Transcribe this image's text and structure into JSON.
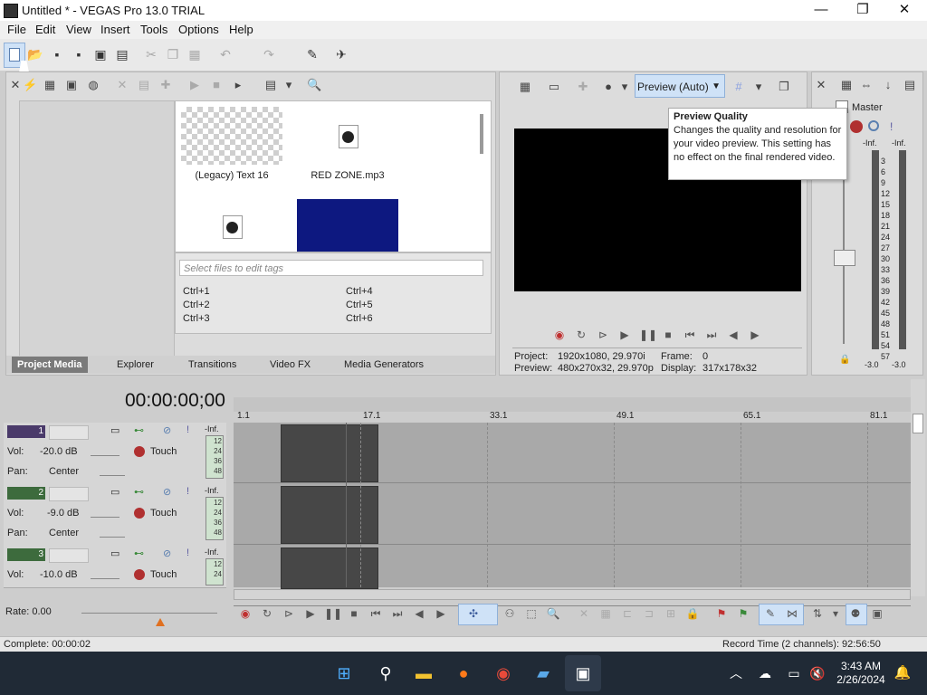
{
  "window": {
    "title": "Untitled * - VEGAS Pro 13.0 TRIAL",
    "controls": {
      "minimize": "—",
      "maximize": "❐",
      "close": "✕"
    }
  },
  "menu": [
    "File",
    "Edit",
    "View",
    "Insert",
    "Tools",
    "Options",
    "Help"
  ],
  "project_media": {
    "items": [
      {
        "label": "(Legacy) Text 16",
        "type": "text-media"
      },
      {
        "label": "RED ZONE.mp3",
        "type": "audio-file"
      },
      {
        "label": "",
        "type": "audio-file"
      },
      {
        "label": "",
        "type": "video-thumb"
      }
    ],
    "tag_placeholder": "Select files to edit tags",
    "shortcuts": [
      "Ctrl+1",
      "Ctrl+2",
      "Ctrl+3",
      "Ctrl+4",
      "Ctrl+5",
      "Ctrl+6"
    ],
    "tabs": [
      "Project Media",
      "Explorer",
      "Transitions",
      "Video FX",
      "Media Generators"
    ],
    "active_tab": "Project Media"
  },
  "preview": {
    "quality_label": "Preview (Auto)",
    "project_label": "Project:",
    "project_value": "1920x1080, 29.970i",
    "preview_label": "Preview:",
    "preview_value": "480x270x32, 29.970p",
    "frame_label": "Frame:",
    "frame_value": "0",
    "display_label": "Display:",
    "display_value": "317x178x32"
  },
  "tooltip": {
    "title": "Preview Quality",
    "body": "Changes the quality and resolution for your video preview. This setting has no effect on the final rendered video."
  },
  "master": {
    "title": "Master",
    "left_inf": "-Inf.",
    "right_inf": "-Inf.",
    "scale": [
      "3",
      "6",
      "9",
      "12",
      "15",
      "18",
      "21",
      "24",
      "27",
      "30",
      "33",
      "36",
      "39",
      "42",
      "45",
      "48",
      "51",
      "54",
      "57"
    ],
    "bottom_left": "-3.0",
    "bottom_right": "-3.0"
  },
  "timeline": {
    "timecode": "00:00:00;00",
    "ruler": [
      "1.1",
      "17.1",
      "33.1",
      "49.1",
      "65.1",
      "81.1"
    ],
    "rate_label": "Rate: 0.00",
    "tracks": [
      {
        "number": "1",
        "kind": "video",
        "vol_label": "Vol:",
        "vol_value": "-20.0 dB",
        "pan_label": "Pan:",
        "pan_value": "Center",
        "mode": "Touch",
        "inf": "-Inf."
      },
      {
        "number": "2",
        "kind": "audio",
        "vol_label": "Vol:",
        "vol_value": "-9.0 dB",
        "pan_label": "Pan:",
        "pan_value": "Center",
        "mode": "Touch",
        "inf": "-Inf."
      },
      {
        "number": "3",
        "kind": "audio",
        "vol_label": "Vol:",
        "vol_value": "-10.0 dB",
        "pan_label": "",
        "pan_value": "",
        "mode": "Touch",
        "inf": "-Inf."
      }
    ],
    "meter_scale": [
      "12",
      "24",
      "36",
      "48"
    ]
  },
  "status": {
    "complete": "Complete: 00:00:02",
    "record_time": "Record Time (2 channels): 92:56:50"
  },
  "taskbar": {
    "time": "3:43 AM",
    "date": "2/26/2024"
  },
  "colors": {
    "accent": "#cfe2f7",
    "track_video": "#4a3a6a",
    "track_audio": "#3d6b3d",
    "clip": "#474747",
    "taskbar": "#202a36"
  }
}
